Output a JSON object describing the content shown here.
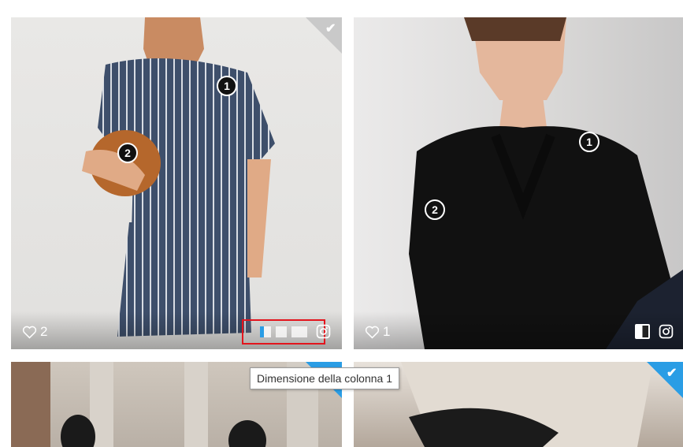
{
  "cards": [
    {
      "likes": "2",
      "hotspots": [
        "1",
        "2"
      ],
      "selected": true,
      "check_color": "grey",
      "column_picker_highlighted": true
    },
    {
      "likes": "1",
      "hotspots": [
        "1",
        "2"
      ],
      "selected": false,
      "column_badge": "single-column"
    },
    {
      "selected": true,
      "check_color": "blue"
    },
    {
      "selected": true,
      "check_color": "blue"
    }
  ],
  "tooltip": {
    "text": "Dimensione della colonna 1"
  },
  "colors": {
    "accent": "#2a9de5",
    "highlight_border": "#e3141d",
    "check_grey": "#c9c9c9"
  },
  "icons": [
    "heart-icon",
    "instagram-icon",
    "checkmark-icon",
    "column-size-icon"
  ]
}
